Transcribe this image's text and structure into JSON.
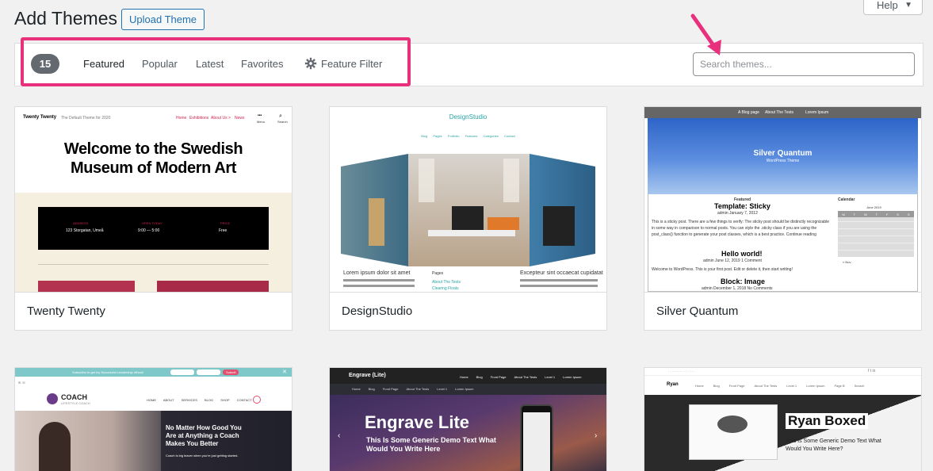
{
  "header": {
    "title": "Add Themes",
    "upload_label": "Upload Theme",
    "help_label": "Help"
  },
  "filter": {
    "count": "15",
    "tabs": [
      "Featured",
      "Popular",
      "Latest",
      "Favorites"
    ],
    "feature_filter": "Feature Filter",
    "search_placeholder": "Search themes...",
    "highlight_color": "#e8307d"
  },
  "themes": [
    {
      "name": "Twenty Twenty",
      "preview": {
        "site_name": "Twenty Twenty",
        "tagline": "The Default Theme for 2020",
        "nav": [
          "Home",
          "Exhibitions",
          "About Us >",
          "News"
        ],
        "menu": "Menu",
        "search": "Search",
        "headline_1": "Welcome to the Swedish",
        "headline_2": "Museum of Modern Art",
        "info": [
          {
            "label": "ADDRESS",
            "value": "123 Storgatan, Umeå"
          },
          {
            "label": "OPEN TODAY",
            "value": "9:00 — 5:00"
          },
          {
            "label": "PRICE",
            "value": "Free"
          }
        ]
      }
    },
    {
      "name": "DesignStudio",
      "preview": {
        "logo": "DesignStudio",
        "nav": [
          "Blog",
          "Pages",
          "Portfolio",
          "Features",
          "Categories",
          "Contact"
        ],
        "col1_title": "Lorem ipsum dolor sit amet",
        "col2_title": "Pages",
        "col2_links": [
          "About The Tests",
          "Clearing Floats"
        ],
        "col3_title": "Excepteur sint occaecat cupidatat"
      }
    },
    {
      "name": "Silver Quantum",
      "preview": {
        "nav": [
          "A Blog page",
          "About The Tests",
          "Lorem Ipsum"
        ],
        "site_title": "Silver Quantum",
        "subtitle": "WordPress Theme",
        "featured": "Featured",
        "post1_title": "Template: Sticky",
        "post1_meta": "admin  January 7, 2012",
        "post1_text": "This is a sticky post. There are a few things to verify: The sticky post should be distinctly recognizable in some way in comparison to normal posts. You can style the .sticky class if you are using the post_class() function to generate your post classes, which is a best practice. Continue reading",
        "post2_title": "Hello world!",
        "post2_meta": "admin  June 12, 2019  1 Comment",
        "post2_text": "Welcome to WordPress. This is your first post. Edit or delete it, then start writing!",
        "post3_title": "Block: Image",
        "post3_meta": "admin  December 1, 2018  No Comments",
        "calendar_title": "Calendar",
        "calendar_month": "June 2019",
        "calendar_days": [
          "M",
          "T",
          "W",
          "T",
          "F",
          "S",
          "S"
        ],
        "calendar_prev": "« Nov"
      }
    },
    {
      "name": "Coach",
      "preview": {
        "banner": "Subscribe to get my Successful Leadership eBook!",
        "banner_button": "Submit",
        "logo": "COACH",
        "logo_sub": "LIFESTYLE COACH",
        "nav": [
          "HOME",
          "ABOUT",
          "SERVICES",
          "BLOG",
          "SHOP",
          "CONTACT"
        ],
        "headline": "No Matter How Good You Are at Anything a Coach Makes You Better",
        "sub": "Coach is big leaver when you're just getting started."
      }
    },
    {
      "name": "Engrave (Lite)",
      "preview": {
        "logo": "Engrave (Lite)",
        "nav": [
          "Home",
          "Blog",
          "Front Page",
          "About The Tests",
          "Level 1",
          "Lorem Ipsum"
        ],
        "subnav": [
          "Home",
          "Blog",
          "Front Page",
          "About The Tests",
          "Level 1",
          "Lorem Ipsum"
        ],
        "headline": "Engrave Lite",
        "sub": "This Is Some Generic Demo Text What Would You Write Here"
      }
    },
    {
      "name": "Ryan Boxed",
      "preview": {
        "logo": "Ryan",
        "nav": [
          "Home",
          "Blog",
          "Front Page",
          "About The Tests",
          "Level 1",
          "Lorem Ipsum",
          "Page B",
          "Search"
        ],
        "headline": "Ryan Boxed",
        "sub": "This Is Some Generic Demo Text What Would You Write Here?"
      }
    }
  ]
}
